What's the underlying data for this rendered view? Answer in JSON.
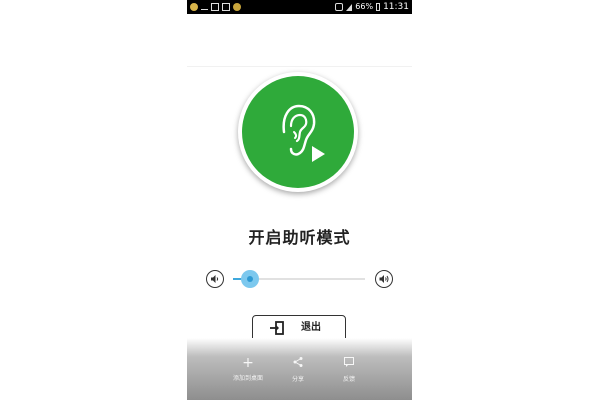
{
  "status_bar": {
    "battery": "66%",
    "time": "11:31"
  },
  "hero": {
    "icon": "ear-play-icon",
    "color": "#2faa3a"
  },
  "title": "开启助听模式",
  "volume": {
    "level": 0.13,
    "accent": "#3fa8dc"
  },
  "exit_button": {
    "label": "退出"
  },
  "bottom_nav": [
    {
      "icon": "plus-icon",
      "label": "添加到桌面"
    },
    {
      "icon": "share-icon",
      "label": "分享"
    },
    {
      "icon": "feedback-icon",
      "label": "反馈"
    }
  ]
}
